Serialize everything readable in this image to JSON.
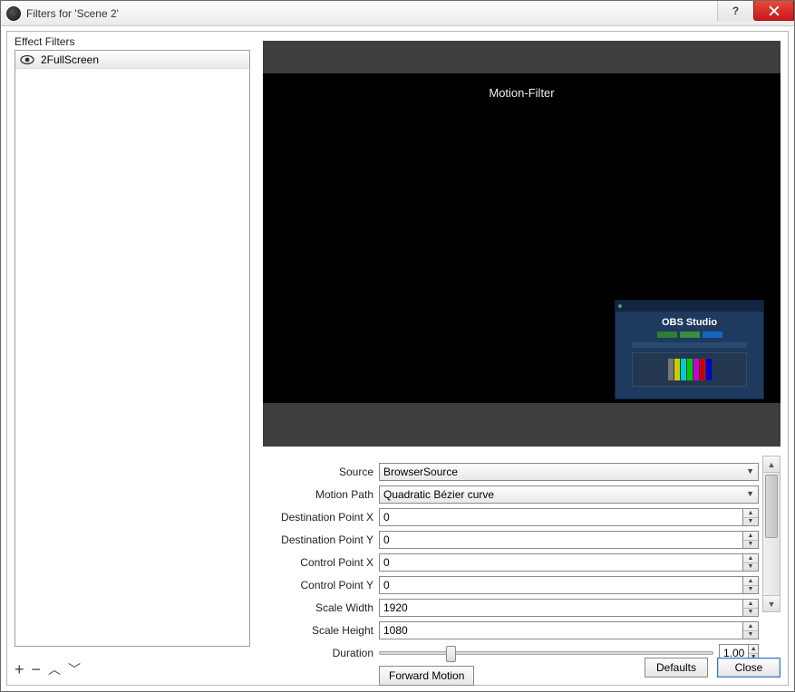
{
  "window": {
    "title": "Filters for 'Scene 2'"
  },
  "sidebar": {
    "label": "Effect Filters",
    "items": [
      {
        "name": "2FullScreen"
      }
    ]
  },
  "preview": {
    "caption": "Motion-Filter",
    "miniTitle": "OBS Studio"
  },
  "props": {
    "sourceLabel": "Source",
    "sourceValue": "BrowserSource",
    "motionPathLabel": "Motion Path",
    "motionPathValue": "Quadratic Bézier curve",
    "destXLabel": "Destination Point X",
    "destXValue": "0",
    "destYLabel": "Destination Point Y",
    "destYValue": "0",
    "ctrlXLabel": "Control Point X",
    "ctrlXValue": "0",
    "ctrlYLabel": "Control Point Y",
    "ctrlYValue": "0",
    "scaleWLabel": "Scale Width",
    "scaleWValue": "1920",
    "scaleHLabel": "Scale Height",
    "scaleHValue": "1080",
    "durationLabel": "Duration",
    "durationValue": "1.00",
    "forwardMotion": "Forward Motion"
  },
  "buttons": {
    "defaults": "Defaults",
    "close": "Close"
  }
}
